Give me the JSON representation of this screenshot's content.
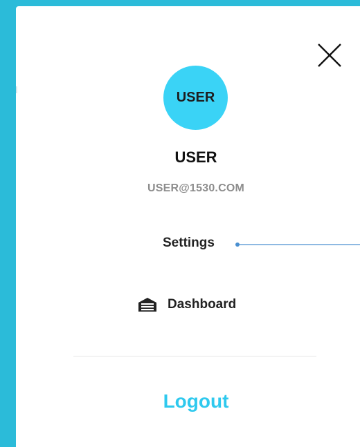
{
  "user": {
    "avatar_text": "USER",
    "name": "USER",
    "email": "USER@1530.COM"
  },
  "menu": {
    "settings_label": "Settings",
    "dashboard_label": "Dashboard"
  },
  "actions": {
    "logout_label": "Logout"
  },
  "icons": {
    "close": "close-icon",
    "dashboard": "garage-icon"
  },
  "colors": {
    "background": "#2bbbd9",
    "avatar": "#3ad3f6",
    "logout": "#2fc9ee",
    "email": "#8d8d8d"
  }
}
